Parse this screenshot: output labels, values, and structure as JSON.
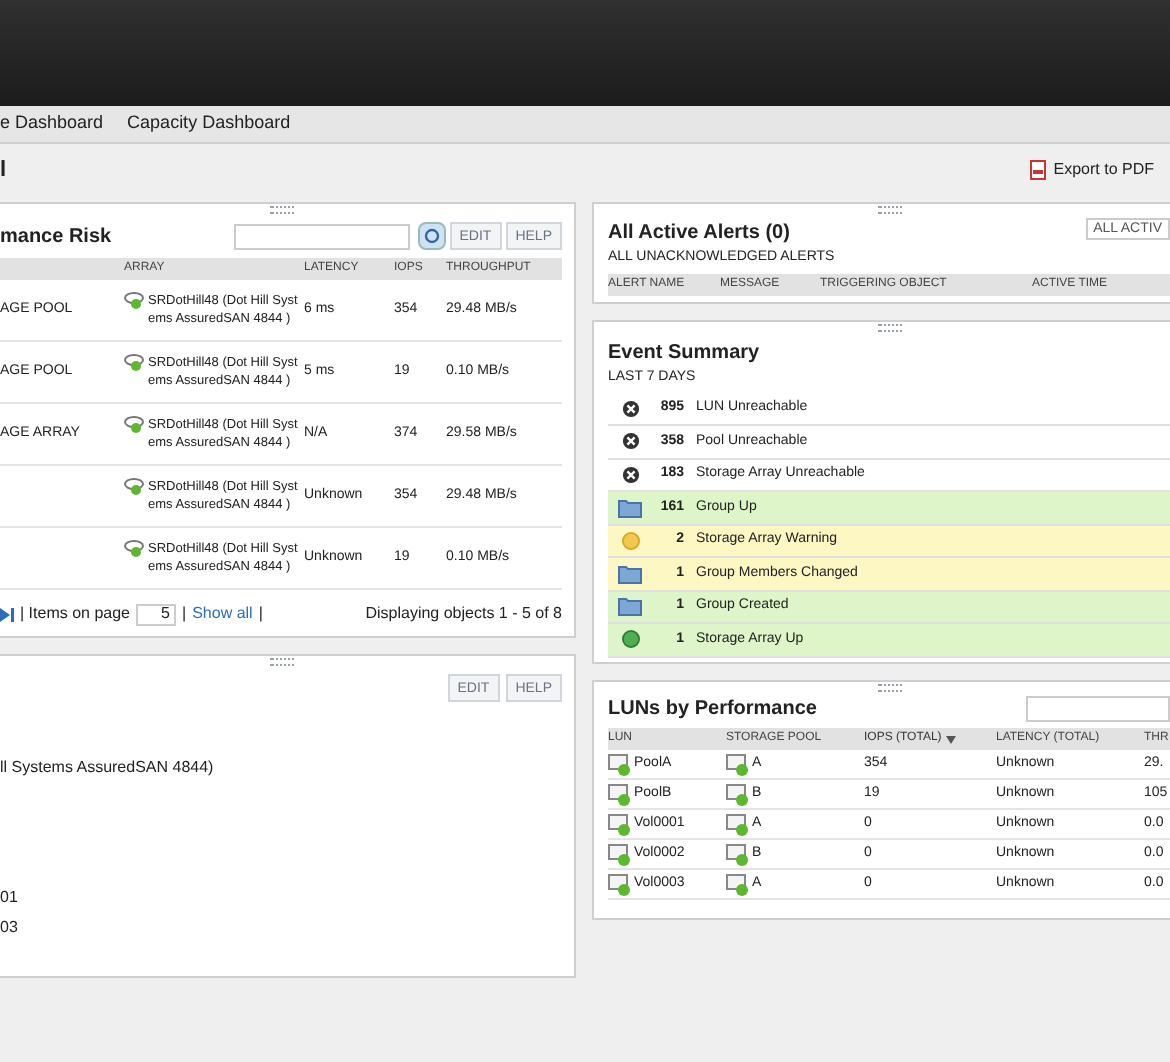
{
  "nav": [
    {
      "label": "e Dashboard",
      "selected": false
    },
    {
      "label": "Capacity Dashboard",
      "selected": false
    }
  ],
  "page_title": "l",
  "export_label": "Export to PDF",
  "risk_panel": {
    "title": "mance Risk",
    "buttons": [
      "EDIT",
      "HELP"
    ],
    "columns": [
      "",
      "ARRAY",
      "LATENCY",
      "IOPS",
      "THROUGHPUT"
    ],
    "rows": [
      {
        "type": "AGE POOL",
        "array": "SRDotHill48 (Dot Hill Systems AssuredSAN 4844 )",
        "latency": "6 ms",
        "iops": "354",
        "throughput": "29.48 MB/s"
      },
      {
        "type": "AGE POOL",
        "array": "SRDotHill48 (Dot Hill Systems AssuredSAN 4844 )",
        "latency": "5 ms",
        "iops": "19",
        "throughput": "0.10 MB/s"
      },
      {
        "type": "AGE ARRAY",
        "array": "SRDotHill48 (Dot Hill Systems AssuredSAN 4844 )",
        "latency": "N/A",
        "iops": "374",
        "throughput": "29.58 MB/s"
      },
      {
        "type": "",
        "array": "SRDotHill48 (Dot Hill Systems AssuredSAN 4844 )",
        "latency": "Unknown",
        "iops": "354",
        "throughput": "29.48 MB/s"
      },
      {
        "type": "",
        "array": "SRDotHill48 (Dot Hill Systems AssuredSAN 4844 )",
        "latency": "Unknown",
        "iops": "19",
        "throughput": "0.10 MB/s"
      }
    ],
    "items_label": "| Items on page",
    "items_value": "5",
    "show_all": "Show all",
    "pipe": "|",
    "displaying": "Displaying objects 1 - 5 of 8"
  },
  "detail_panel": {
    "buttons": [
      "EDIT",
      "HELP"
    ],
    "lines": [
      "ll Systems AssuredSAN 4844)",
      "01",
      "03"
    ]
  },
  "alerts_panel": {
    "title": "All Active Alerts (0)",
    "button": "ALL ACTIV",
    "subtitle": "ALL UNACKNOWLEDGED ALERTS",
    "columns": [
      "ALERT NAME",
      "MESSAGE",
      "TRIGGERING OBJECT",
      "ACTIVE TIME"
    ]
  },
  "event_panel": {
    "title": "Event Summary",
    "subtitle": "LAST 7 DAYS",
    "events": [
      {
        "kind": "error",
        "count": "895",
        "label": "LUN Unreachable",
        "color": "#ffffff"
      },
      {
        "kind": "error",
        "count": "358",
        "label": "Pool Unreachable",
        "color": "#ffffff"
      },
      {
        "kind": "error",
        "count": "183",
        "label": "Storage Array Unreachable",
        "color": "#ffffff"
      },
      {
        "kind": "group",
        "count": "161",
        "label": "Group Up",
        "color": "#ddf5c9"
      },
      {
        "kind": "warning",
        "count": "2",
        "label": "Storage Array Warning",
        "color": "#fdf7c4"
      },
      {
        "kind": "group",
        "count": "1",
        "label": "Group Members Changed",
        "color": "#fdf7c4"
      },
      {
        "kind": "group",
        "count": "1",
        "label": "Group Created",
        "color": "#ddf5c9"
      },
      {
        "kind": "up",
        "count": "1",
        "label": "Storage Array Up",
        "color": "#ddf5c9"
      }
    ]
  },
  "luns_panel": {
    "title": "LUNs by Performance",
    "columns": [
      {
        "label": "LUN",
        "sorted": false
      },
      {
        "label": "STORAGE POOL",
        "sorted": false
      },
      {
        "label": "IOPS (TOTAL)",
        "sorted": true
      },
      {
        "label": "LATENCY (TOTAL)",
        "sorted": false
      },
      {
        "label": "THR",
        "sorted": false
      }
    ],
    "rows": [
      {
        "lun": "PoolA",
        "pool": "A",
        "iops": "354",
        "latency": "Unknown",
        "throughput": "29."
      },
      {
        "lun": "PoolB",
        "pool": "B",
        "iops": "19",
        "latency": "Unknown",
        "throughput": "105"
      },
      {
        "lun": "Vol0001",
        "pool": "A",
        "iops": "0",
        "latency": "Unknown",
        "throughput": "0.0"
      },
      {
        "lun": "Vol0002",
        "pool": "B",
        "iops": "0",
        "latency": "Unknown",
        "throughput": "0.0"
      },
      {
        "lun": "Vol0003",
        "pool": "A",
        "iops": "0",
        "latency": "Unknown",
        "throughput": "0.0"
      }
    ]
  }
}
